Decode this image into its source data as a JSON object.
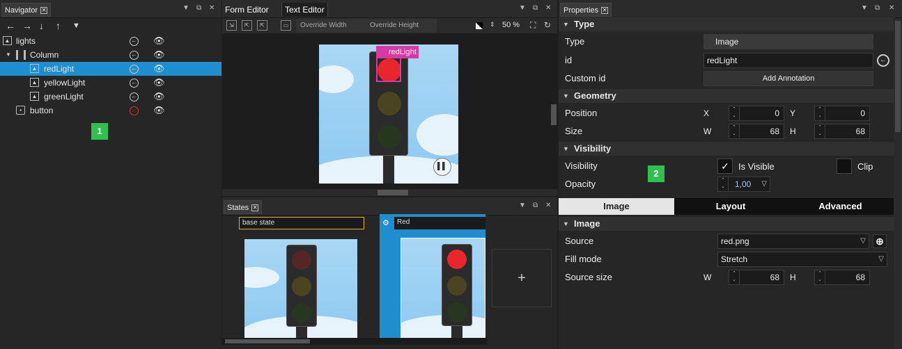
{
  "navigator": {
    "title": "Navigator",
    "badge": "1",
    "nodes": [
      {
        "label": "lights"
      },
      {
        "label": "Column"
      },
      {
        "label": "redLight"
      },
      {
        "label": "yellowLight"
      },
      {
        "label": "greenLight"
      },
      {
        "label": "button"
      }
    ]
  },
  "editor": {
    "tab_form": "Form Editor",
    "tab_text": "Text Editor",
    "override_width": "Override Width",
    "override_height": "Override Height",
    "zoom": "50 %",
    "selection_label": "redLight"
  },
  "states": {
    "title": "States",
    "base_state": "base state",
    "red_state": "Red",
    "add": "+"
  },
  "properties": {
    "title": "Properties",
    "badge": "2",
    "sections": {
      "type": "Type",
      "geometry": "Geometry",
      "visibility": "Visibility",
      "image": "Image"
    },
    "type_label": "Type",
    "type_value": "Image",
    "id_label": "id",
    "id_value": "redLight",
    "custom_id_label": "Custom id",
    "add_annotation": "Add Annotation",
    "position_label": "Position",
    "x_label": "X",
    "x_value": "0",
    "y_label": "Y",
    "y_value": "0",
    "size_label": "Size",
    "w_label": "W",
    "w_value": "68",
    "h_label": "H",
    "h_value": "68",
    "visibility_label": "Visibility",
    "is_visible": "Is Visible",
    "clip": "Clip",
    "opacity_label": "Opacity",
    "opacity_value": "1,00",
    "tabs": [
      "Image",
      "Layout",
      "Advanced"
    ],
    "source_label": "Source",
    "source_value": "red.png",
    "fill_mode_label": "Fill mode",
    "fill_mode_value": "Stretch",
    "source_size_label": "Source size",
    "ss_w_label": "W",
    "ss_w_value": "68",
    "ss_h_label": "H",
    "ss_h_value": "68"
  },
  "colors": {
    "selection": "#1e8ecf",
    "badge": "#2ec14f",
    "red_lamp": "#e8262b",
    "handle": "#d63aa5",
    "state_bg": "#1e8ecf"
  }
}
